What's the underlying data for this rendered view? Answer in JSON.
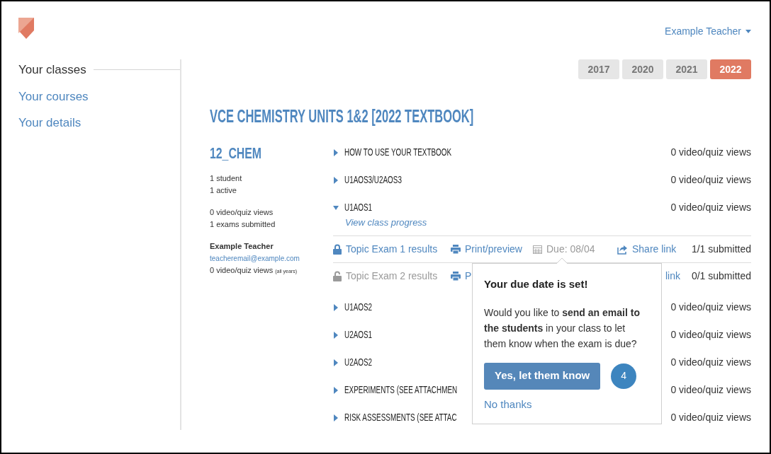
{
  "header": {
    "user_menu": "Example Teacher"
  },
  "sidebar": {
    "items": [
      {
        "label": "Your classes",
        "selected": true
      },
      {
        "label": "Your courses",
        "selected": false
      },
      {
        "label": "Your details",
        "selected": false
      }
    ]
  },
  "years": [
    {
      "label": "2017",
      "selected": false
    },
    {
      "label": "2020",
      "selected": false
    },
    {
      "label": "2021",
      "selected": false
    },
    {
      "label": "2022",
      "selected": true
    }
  ],
  "course_title": "VCE CHEMISTRY UNITS 1&2 [2022 TEXTBOOK]",
  "class": {
    "name": "12_CHEM",
    "stat_groups": [
      [
        "1 student",
        "1 active"
      ],
      [
        "0 video/quiz views",
        "1 exams submitted"
      ]
    ],
    "teacher": {
      "name": "Example Teacher",
      "email": "teacheremail@example.com",
      "views": "0 video/quiz views",
      "views_note": "(all years)"
    }
  },
  "topics": [
    {
      "title": "HOW TO USE YOUR TEXTBOOK",
      "views": "0 video/quiz views",
      "expanded": false
    },
    {
      "title": "U1AOS3/U2AOS3",
      "views": "0 video/quiz views",
      "expanded": false
    },
    {
      "title": "U1AOS1",
      "views": "0 video/quiz views",
      "expanded": true,
      "link": "View class progress",
      "exams": [
        {
          "title": "Topic Exam 1 results",
          "locked": true,
          "print": "Print/preview",
          "due": "Due: 08/04",
          "share": "Share link",
          "submitted": "1/1 submitted"
        },
        {
          "title": "Topic Exam 2 results",
          "locked": false,
          "print": "P",
          "share": "link",
          "submitted": "0/1 submitted"
        }
      ]
    },
    {
      "title": "U1AOS2",
      "views": "0 video/quiz views",
      "expanded": false
    },
    {
      "title": "U2AOS1",
      "views": "0 video/quiz views",
      "expanded": false
    },
    {
      "title": "U2AOS2",
      "views": "0 video/quiz views",
      "expanded": false
    },
    {
      "title": "EXPERIMENTS (SEE ATTACHMEN",
      "views": "0 video/quiz views",
      "expanded": false
    },
    {
      "title": "RISK ASSESSMENTS (SEE ATTAC",
      "views": "0 video/quiz views",
      "expanded": false
    }
  ],
  "popover": {
    "title": "Your due date is set!",
    "body": "Would you like to **send an email to the students** in your class to let them know when the exam is due?",
    "primary": "Yes, let them know",
    "badge": "4",
    "secondary": "No thanks"
  }
}
